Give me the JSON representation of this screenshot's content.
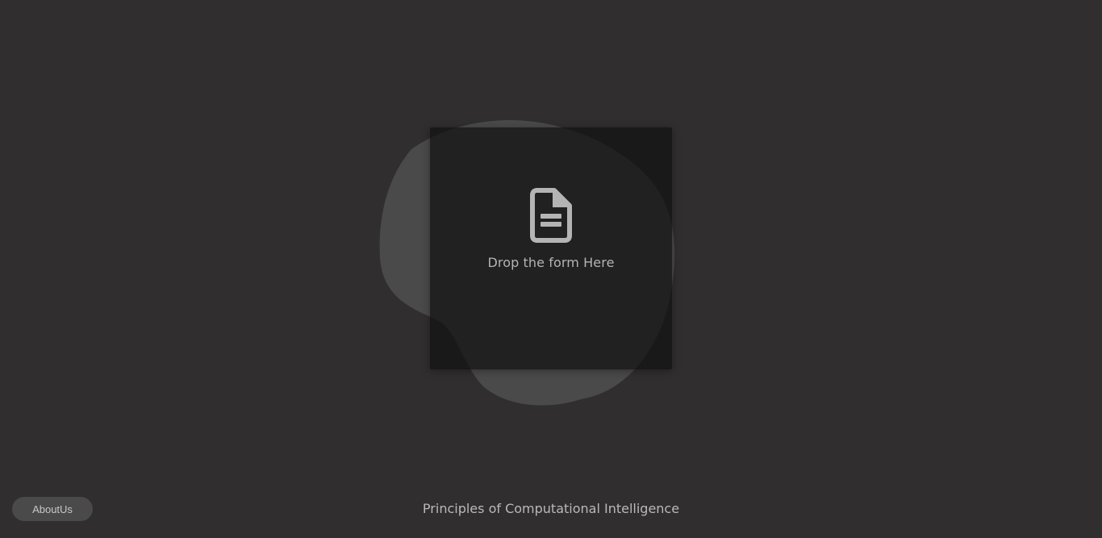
{
  "dropzone": {
    "label": "Drop the form Here",
    "icon": "document-icon"
  },
  "footer": {
    "about_label": "AboutUs",
    "title": "Principles of Computational Intelligence"
  },
  "colors": {
    "background": "#302e2f",
    "blob": "#4a4a4a",
    "dropzone": "#1c1c1c",
    "icon": "#b4b4b4",
    "text": "#b9b9b9"
  }
}
